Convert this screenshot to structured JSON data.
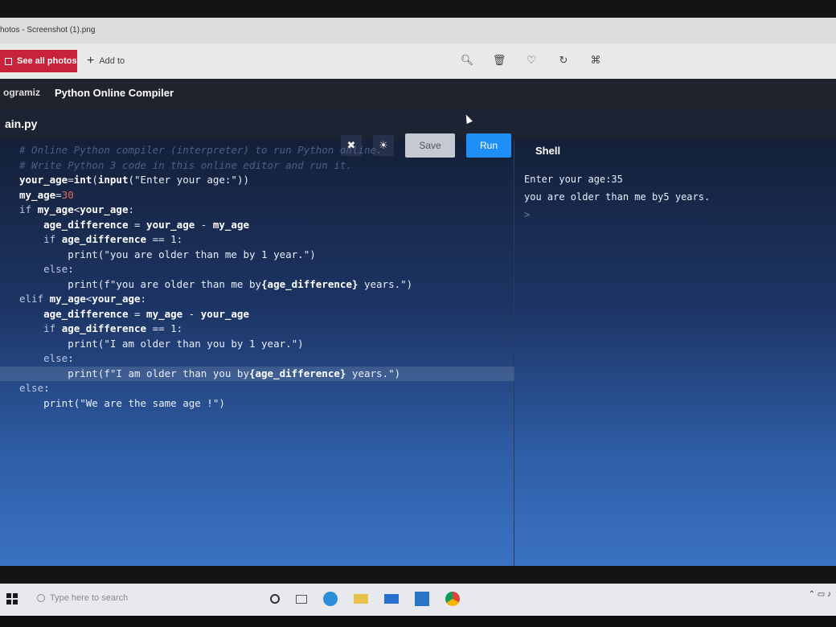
{
  "photos": {
    "window_title": "hotos - Screenshot (1).png",
    "see_all": "See all photos",
    "add_to": "Add to",
    "tools": [
      "zoom-icon",
      "delete-icon",
      "heart-icon",
      "rotate-icon",
      "crop-icon"
    ]
  },
  "site": {
    "brand": "ogramiz",
    "title": "Python Online Compiler"
  },
  "editor": {
    "file_tab": "ain.py",
    "save_label": "Save",
    "run_label": "Run",
    "lines": [
      {
        "type": "comment",
        "text": "# Online Python compiler (interpreter) to run Python online."
      },
      {
        "type": "comment",
        "text": "# Write Python 3 code in this online editor and run it."
      },
      {
        "type": "code",
        "parts": [
          [
            "b",
            "your_age"
          ],
          [
            "",
            "="
          ],
          [
            "b",
            "int"
          ],
          [
            "",
            "("
          ],
          [
            "b",
            "input"
          ],
          [
            "",
            "(\"Enter your age:\"))"
          ]
        ]
      },
      {
        "type": "code",
        "parts": [
          [
            "b",
            "my_age"
          ],
          [
            "",
            "="
          ],
          [
            "num",
            "30"
          ]
        ]
      },
      {
        "type": "code",
        "parts": [
          [
            "kw",
            "if "
          ],
          [
            "b",
            "my_age"
          ],
          [
            "",
            "<"
          ],
          [
            "b",
            "your_age"
          ],
          [
            "",
            ":"
          ]
        ]
      },
      {
        "type": "code",
        "parts": [
          [
            "",
            "    "
          ],
          [
            "b",
            "age_difference"
          ],
          [
            "",
            " = "
          ],
          [
            "b",
            "your_age"
          ],
          [
            "",
            " - "
          ],
          [
            "b",
            "my_age"
          ]
        ]
      },
      {
        "type": "code",
        "parts": [
          [
            "kw",
            "    if "
          ],
          [
            "b",
            "age_difference"
          ],
          [
            "",
            " == 1:"
          ]
        ]
      },
      {
        "type": "code",
        "parts": [
          [
            "",
            "        print(\"you are older than me by 1 year.\")"
          ]
        ]
      },
      {
        "type": "code",
        "parts": [
          [
            "kw",
            "    else"
          ],
          [
            "",
            ":"
          ]
        ]
      },
      {
        "type": "code",
        "parts": [
          [
            "",
            "        print(f\"you are older than me by"
          ],
          [
            "b",
            "{age_difference}"
          ],
          [
            "",
            " years.\")"
          ]
        ]
      },
      {
        "type": "code",
        "parts": [
          [
            "kw",
            "elif "
          ],
          [
            "b",
            "my_age"
          ],
          [
            "",
            "<"
          ],
          [
            "b",
            "your_age"
          ],
          [
            "",
            ":"
          ]
        ]
      },
      {
        "type": "code",
        "parts": [
          [
            "",
            "    "
          ],
          [
            "b",
            "age_difference"
          ],
          [
            "",
            " = "
          ],
          [
            "b",
            "my_age"
          ],
          [
            "",
            " - "
          ],
          [
            "b",
            "your_age"
          ]
        ]
      },
      {
        "type": "code",
        "parts": [
          [
            "kw",
            "    if "
          ],
          [
            "b",
            "age_difference"
          ],
          [
            "",
            " == 1:"
          ]
        ]
      },
      {
        "type": "code",
        "parts": [
          [
            "",
            "        print(\"I am older than you by 1 year.\")"
          ]
        ]
      },
      {
        "type": "code",
        "parts": [
          [
            "kw",
            "    else"
          ],
          [
            "",
            ":"
          ]
        ]
      },
      {
        "type": "code",
        "hl": true,
        "parts": [
          [
            "",
            "        print(f\"I am older than you by"
          ],
          [
            "b",
            "{age_difference}"
          ],
          [
            "",
            " years.\")"
          ]
        ]
      },
      {
        "type": "code",
        "parts": [
          [
            "kw",
            "else"
          ],
          [
            "",
            ":"
          ]
        ]
      },
      {
        "type": "code",
        "parts": [
          [
            "",
            "    print(\"We are the same age !\")"
          ]
        ]
      }
    ]
  },
  "shell": {
    "title": "Shell",
    "output_line1": "Enter your age:35",
    "output_line2": "you are older than me by5 years.",
    "prompt": ">"
  },
  "taskbar": {
    "search_placeholder": "Type here to search",
    "icons": [
      "task-view-icon",
      "edge-icon",
      "file-explorer-icon",
      "mail-icon",
      "photos-icon",
      "chrome-icon"
    ]
  }
}
